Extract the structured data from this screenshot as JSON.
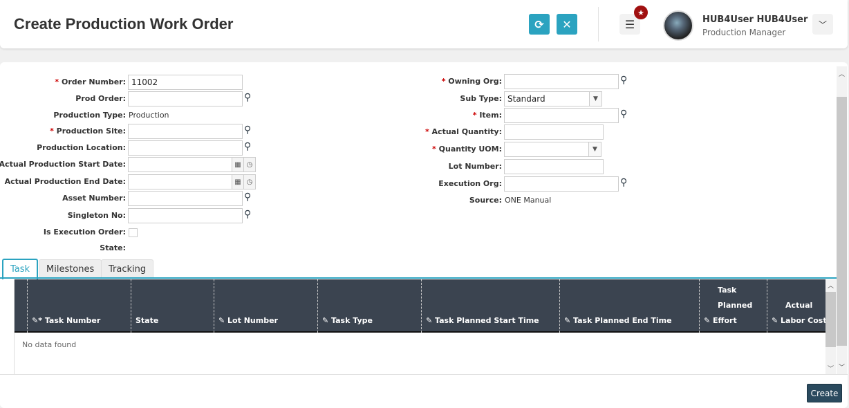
{
  "header": {
    "title": "Create Production Work Order",
    "user_name": "HUB4User HUB4User",
    "user_role": "Production Manager"
  },
  "form_left": [
    {
      "label": "Order Number",
      "required": true,
      "value": "11002"
    },
    {
      "label": "Prod Order",
      "value": ""
    },
    {
      "label": "Production Type",
      "value": "Production"
    },
    {
      "label": "Production Site",
      "required": true,
      "value": ""
    },
    {
      "label": "Production Location",
      "value": ""
    },
    {
      "label": "Actual Production Start Date",
      "value": ""
    },
    {
      "label": "Actual Production End Date",
      "value": ""
    },
    {
      "label": "Asset Number",
      "value": ""
    },
    {
      "label": "Singleton No",
      "value": ""
    },
    {
      "label": "Is Execution Order",
      "checked": false
    },
    {
      "label": "State",
      "value": ""
    }
  ],
  "form_right": [
    {
      "label": "Owning Org",
      "required": true,
      "value": ""
    },
    {
      "label": "Sub Type",
      "value": "Standard"
    },
    {
      "label": "Item",
      "required": true,
      "value": ""
    },
    {
      "label": "Actual Quantity",
      "required": true,
      "value": ""
    },
    {
      "label": "Quantity UOM",
      "required": true,
      "value": ""
    },
    {
      "label": "Lot Number",
      "value": ""
    },
    {
      "label": "Execution Org",
      "value": ""
    },
    {
      "label": "Source",
      "value": "ONE Manual"
    }
  ],
  "tabs": [
    "Task",
    "Milestones",
    "Tracking"
  ],
  "grid": {
    "columns": [
      {
        "l1": "",
        "l2": "",
        "l3": "Task Number"
      },
      {
        "l1": "",
        "l2": "",
        "l3": "State"
      },
      {
        "l1": "",
        "l2": "",
        "l3": "Lot Number"
      },
      {
        "l1": "",
        "l2": "",
        "l3": "Task Type"
      },
      {
        "l1": "",
        "l2": "",
        "l3": "Task Planned Start Time"
      },
      {
        "l1": "",
        "l2": "",
        "l3": "Task Planned End Time"
      },
      {
        "l1": "Task",
        "l2": "Planned",
        "l3": "Effort"
      },
      {
        "l1": "",
        "l2": "Actual",
        "l3": "Labor Cost"
      }
    ],
    "empty_text": "No data found"
  },
  "footer": {
    "create_label": "Create"
  },
  "colors": {
    "accent": "#2ba3c0",
    "grid_header": "#3b4450",
    "create": "#2a4a5e",
    "badge": "#a01010"
  }
}
